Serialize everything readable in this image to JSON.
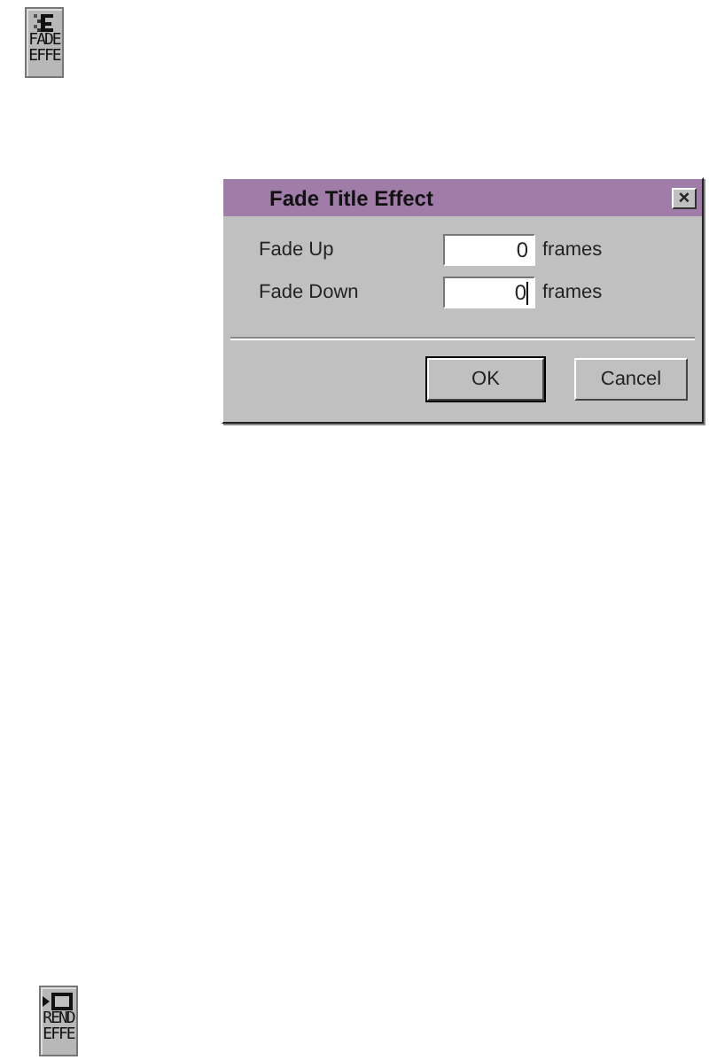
{
  "desktop_icons": [
    {
      "kind": "fade",
      "lines": [
        "FADE",
        "EFFE"
      ]
    },
    {
      "kind": "render",
      "lines": [
        "REND",
        "EFFE"
      ]
    }
  ],
  "dialog": {
    "title": "Fade Title Effect",
    "close": "×",
    "fields": [
      {
        "label": "Fade Up",
        "value": "0",
        "unit": "frames",
        "focused": false
      },
      {
        "label": "Fade Down",
        "value": "0",
        "unit": "frames",
        "focused": true
      }
    ],
    "buttons": [
      {
        "label": "OK",
        "default": true
      },
      {
        "label": "Cancel",
        "default": false
      }
    ]
  }
}
